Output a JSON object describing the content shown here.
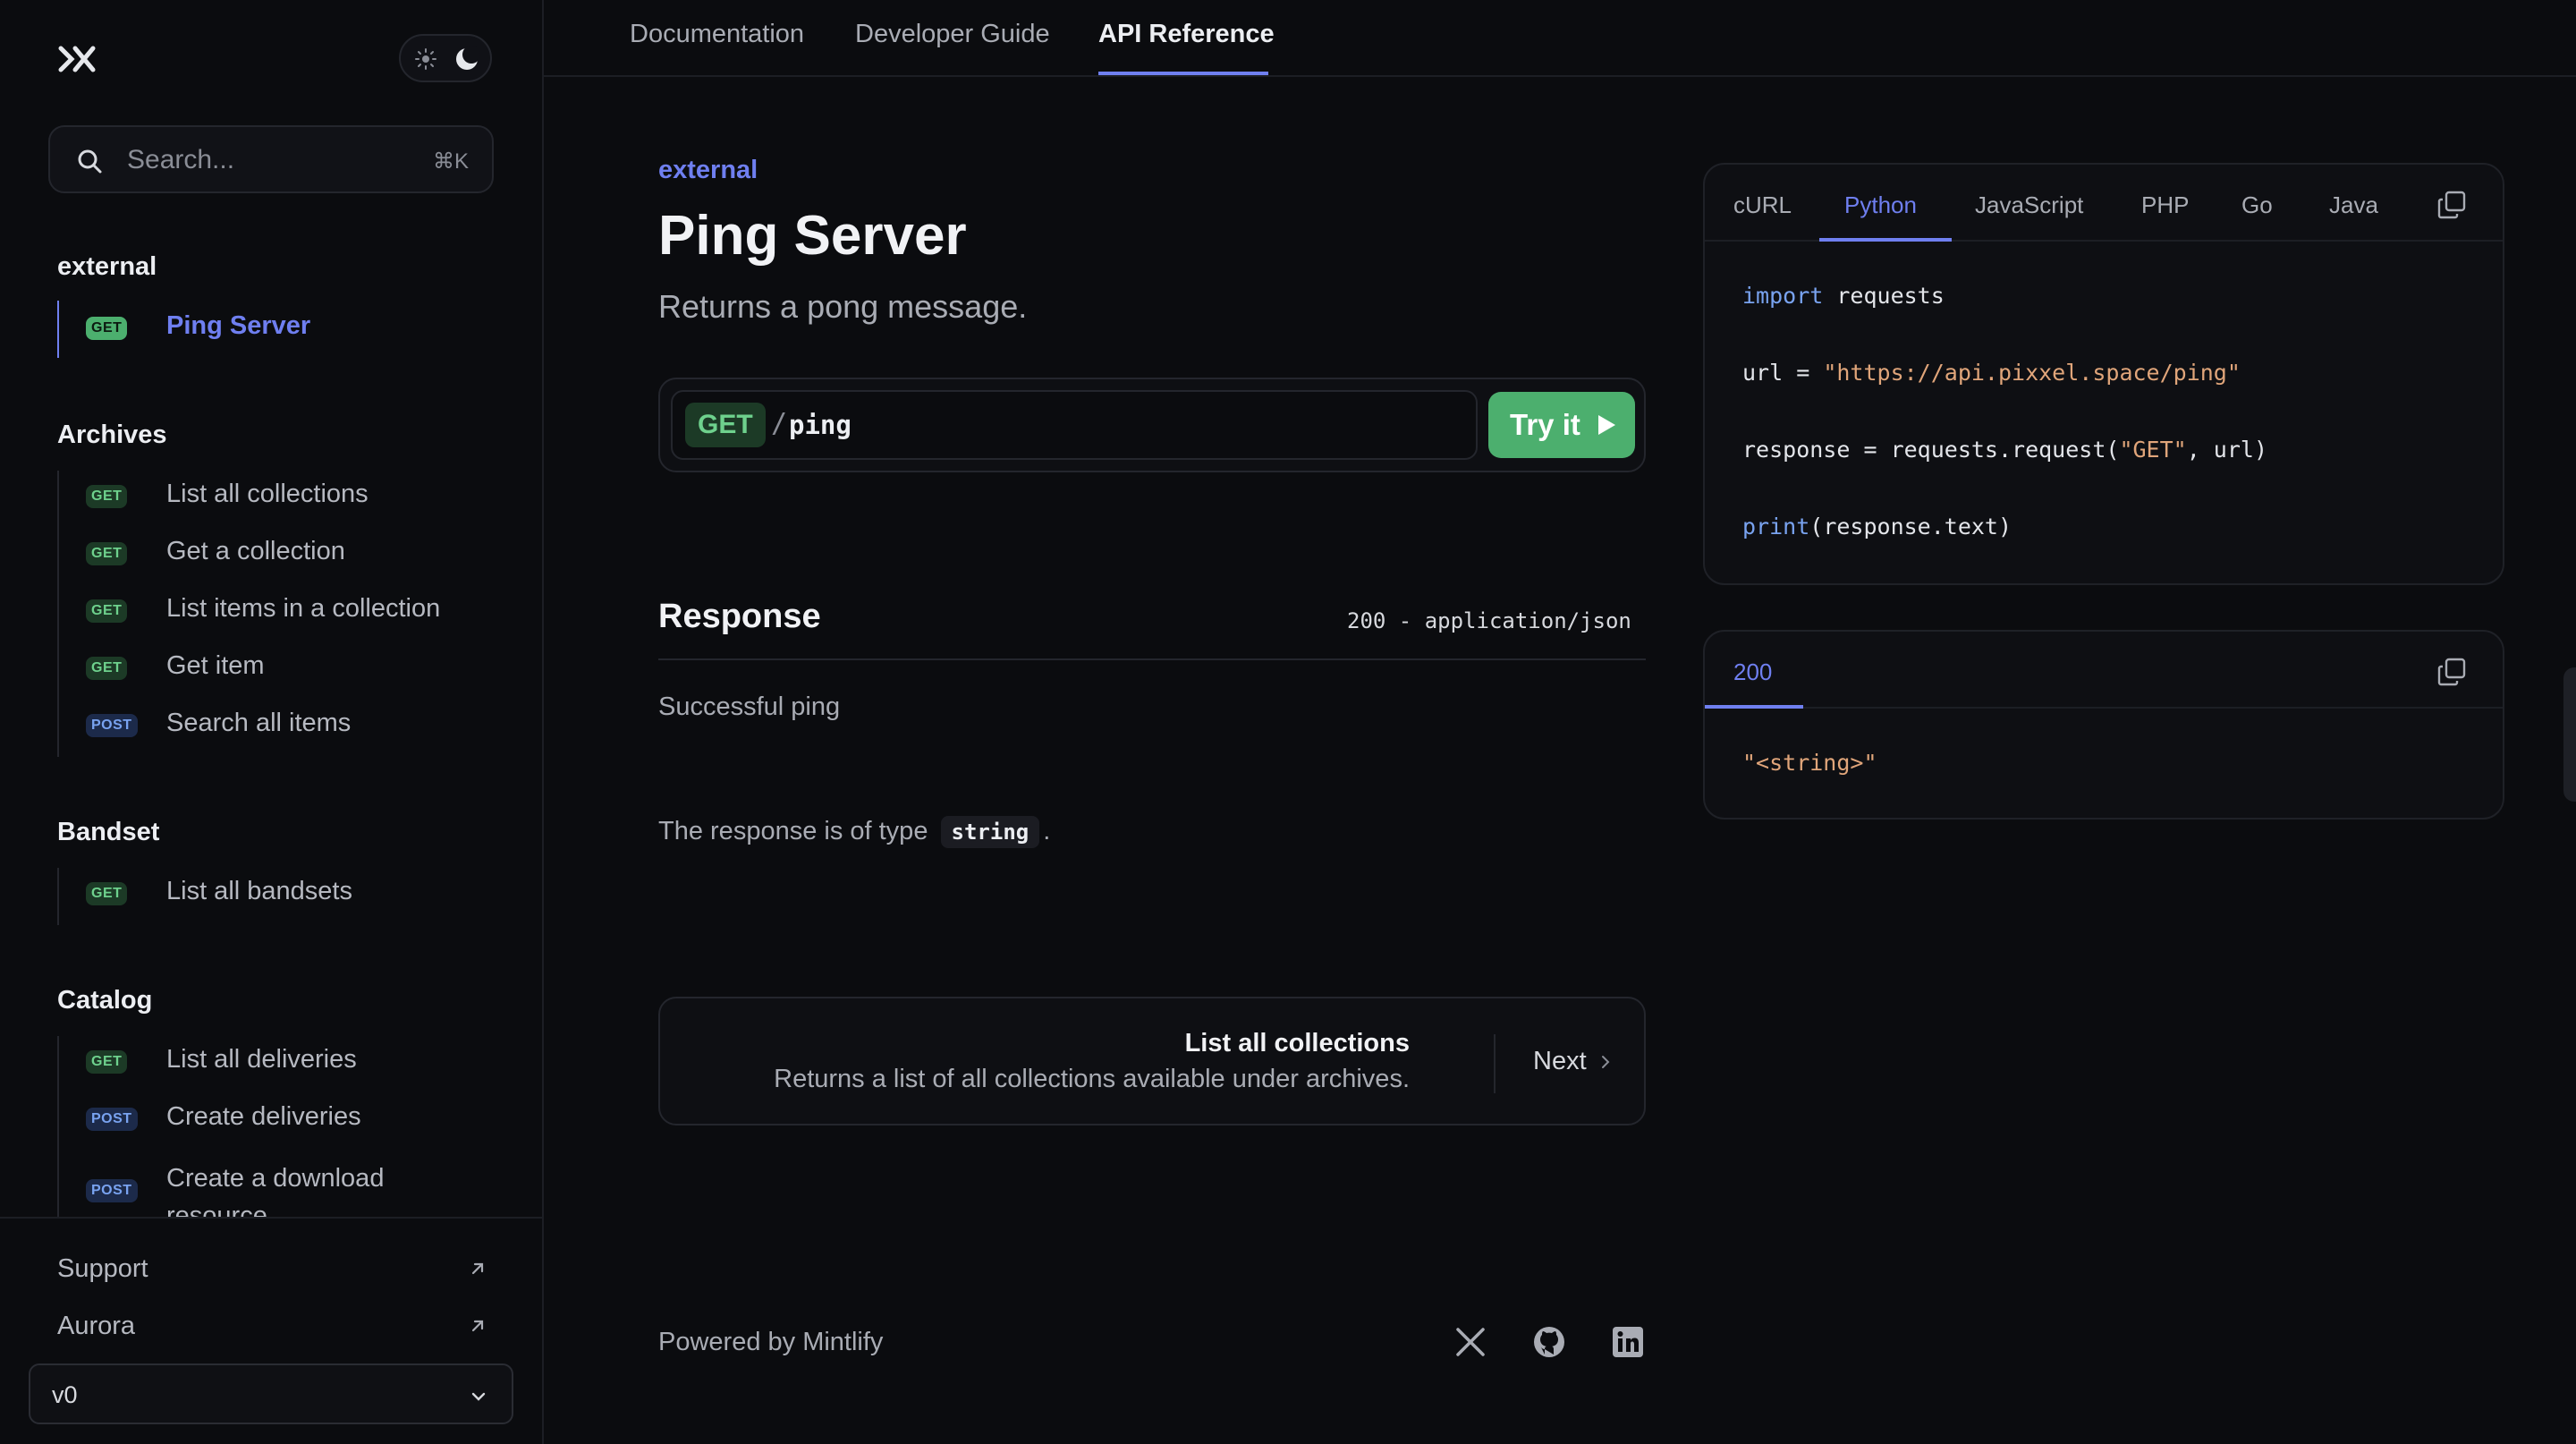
{
  "sidebar": {
    "logo": "mintlify-logo-icon",
    "search": {
      "placeholder": "Search...",
      "shortcut": "⌘K"
    },
    "groups": [
      {
        "title": "external",
        "items": [
          {
            "method": "GET",
            "label": "Ping Server",
            "active": true
          }
        ]
      },
      {
        "title": "Archives",
        "items": [
          {
            "method": "GET",
            "label": "List all collections"
          },
          {
            "method": "GET",
            "label": "Get a collection"
          },
          {
            "method": "GET",
            "label": "List items in a collection"
          },
          {
            "method": "GET",
            "label": "Get item"
          },
          {
            "method": "POST",
            "label": "Search all items"
          }
        ]
      },
      {
        "title": "Bandset",
        "items": [
          {
            "method": "GET",
            "label": "List all bandsets"
          }
        ]
      },
      {
        "title": "Catalog",
        "items": [
          {
            "method": "GET",
            "label": "List all deliveries"
          },
          {
            "method": "POST",
            "label": "Create deliveries"
          },
          {
            "method": "POST",
            "label": "Create a download resource"
          }
        ]
      }
    ],
    "footer": {
      "support": "Support",
      "aurora": "Aurora",
      "version": "v0"
    }
  },
  "topnav": {
    "tabs": [
      "Documentation",
      "Developer Guide",
      "API Reference"
    ],
    "active": "API Reference"
  },
  "main": {
    "eyebrow": "external",
    "title": "Ping Server",
    "description": "Returns a pong message.",
    "endpoint": {
      "method": "GET",
      "slash": "/",
      "path": "ping",
      "try_label": "Try it"
    },
    "response": {
      "title": "Response",
      "meta": "200 - application/json",
      "description": "Successful ping",
      "type_prefix": "The response is of type",
      "type": "string",
      "type_suffix": "."
    },
    "next": {
      "title": "List all collections",
      "description": "Returns a list of all collections available under archives.",
      "label": "Next"
    },
    "footer": {
      "powered": "Powered by Mintlify"
    }
  },
  "code_panel": {
    "tabs": [
      "cURL",
      "Python",
      "JavaScript",
      "PHP",
      "Go",
      "Java"
    ],
    "active": "Python",
    "lines": [
      "import requests",
      "url = \"https://api.pixxel.space/ping\"",
      "response = requests.request(\"GET\", url)",
      "print(response.text)"
    ]
  },
  "response_panel": {
    "tab": "200",
    "body": "\"<string>\""
  },
  "colors": {
    "accent": "#6f7ff0",
    "get": "#4caf6e",
    "post": "#79a3f0",
    "background": "#0b0c0f"
  }
}
